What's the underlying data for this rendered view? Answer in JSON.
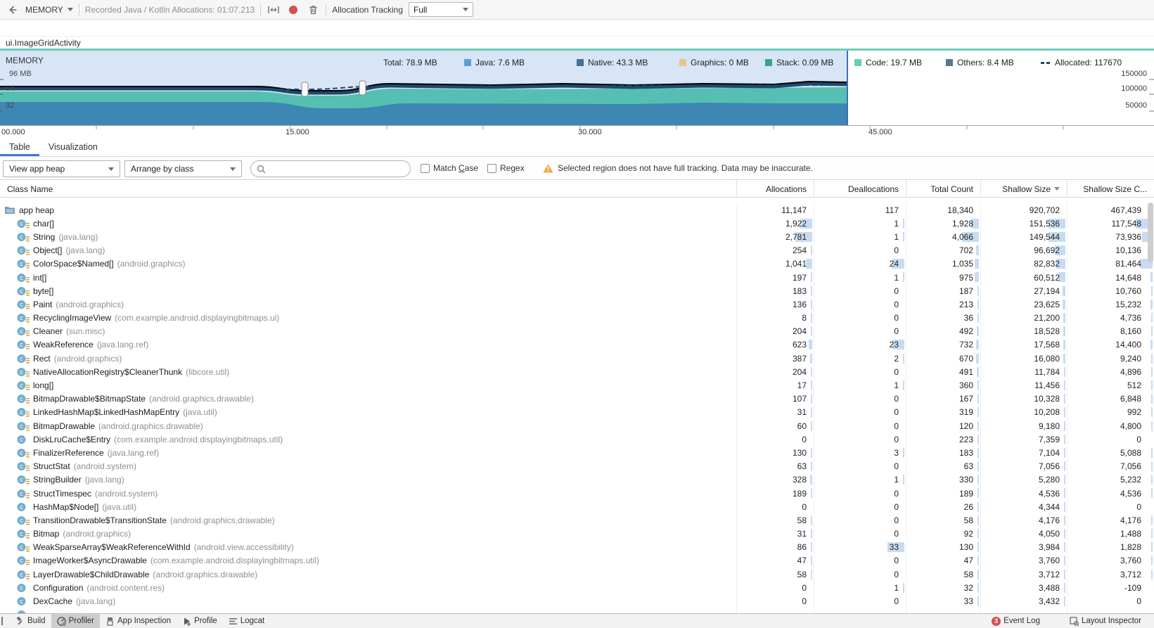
{
  "colors": {
    "accent_blue": "#3e7bc8",
    "selection_bg": "#d8e5f6",
    "event_pink": "#e18cad",
    "activity_teal": "#6cceba",
    "chart_blue_area": "#3e86b3",
    "chart_teal_area": "#55bfb1",
    "total_line": "#000000",
    "allocated_line": "#1d4a6e",
    "java": "#5b9fd3",
    "native": "#44719a",
    "graphics": "#e9c48e",
    "stack": "#39a28b",
    "code": "#68cfae",
    "others": "#56788e",
    "warning_orange": "#f0a732",
    "record_red": "#d6504f"
  },
  "toolbar": {
    "memory_label": "MEMORY",
    "session_label": "Recorded Java / Kotlin Allocations: 01:07.213",
    "tracking_label": "Allocation Tracking",
    "tracking_value": "Full"
  },
  "events": {
    "dots": [
      {
        "x": 412
      },
      {
        "x": 431
      },
      {
        "x": 445
      },
      {
        "x": 474
      },
      {
        "x": 502
      },
      {
        "x": 509
      },
      {
        "x": 516
      },
      {
        "x": 523
      },
      {
        "x": 530
      },
      {
        "x": 538
      },
      {
        "x": 550
      },
      {
        "x": 568
      },
      {
        "x": 851
      },
      {
        "x": 884
      },
      {
        "x": 898
      },
      {
        "x": 910
      },
      {
        "x": 921
      }
    ]
  },
  "activity": {
    "name": "ui.ImageGridActivity"
  },
  "chart": {
    "title": "MEMORY",
    "legend": {
      "total": "Total: 78.9 MB",
      "java": "Java: 7.6 MB",
      "native": "Native: 43.3 MB",
      "graphics": "Graphics: 0 MB",
      "stack": "Stack: 0.09 MB",
      "code": "Code: 19.7 MB",
      "others": "Others: 8.4 MB",
      "allocated": "Allocated: 117670"
    },
    "y_left": [
      "96 MB",
      "64",
      "32"
    ],
    "y_right": [
      "150000",
      "100000",
      "50000"
    ],
    "x_ticks": [
      "00.000",
      "15.000",
      "30.000",
      "45.000"
    ]
  },
  "tabs": {
    "table": "Table",
    "visualization": "Visualization"
  },
  "filters": {
    "view": "View app heap",
    "arrange": "Arrange by class",
    "search_value": "",
    "match_case": {
      "pre": "Match ",
      "u": "C",
      "post": "ase"
    },
    "regex": {
      "pre": "Re",
      "u": "g",
      "post": "ex"
    },
    "warning": "Selected region does not have full tracking. Data may be inaccurate."
  },
  "table": {
    "columns": {
      "name": "Class Name",
      "allocations": "Allocations",
      "deallocations": "Deallocations",
      "total": "Total Count",
      "shallow": "Shallow Size",
      "shallow_change": "Shallow Size C..."
    },
    "rows": [
      {
        "icon": "folder",
        "name": "app heap",
        "pkg": "",
        "a": "11,147",
        "d": "117",
        "t": "18,340",
        "s": "920,702",
        "c": "467,439",
        "agg": true
      },
      {
        "icon": "class",
        "name": "char[]",
        "pkg": "",
        "a": "1,922",
        "d": "1",
        "t": "1,928",
        "s": "151,536",
        "c": "117,548"
      },
      {
        "icon": "class",
        "name": "String",
        "pkg": "(java.lang)",
        "a": "2,781",
        "d": "1",
        "t": "4,066",
        "s": "149,544",
        "c": "73,936"
      },
      {
        "icon": "class",
        "name": "Object[]",
        "pkg": "(java.lang)",
        "a": "254",
        "d": "0",
        "t": "702",
        "s": "96,692",
        "c": "10,136"
      },
      {
        "icon": "class",
        "name": "ColorSpace$Named[]",
        "pkg": "(android.graphics)",
        "a": "1,041",
        "d": "24",
        "t": "1,035",
        "s": "82,832",
        "c": "81,464"
      },
      {
        "icon": "class",
        "name": "int[]",
        "pkg": "",
        "a": "197",
        "d": "1",
        "t": "975",
        "s": "60,512",
        "c": "14,648"
      },
      {
        "icon": "class",
        "name": "byte[]",
        "pkg": "",
        "a": "183",
        "d": "0",
        "t": "187",
        "s": "27,194",
        "c": "10,760"
      },
      {
        "icon": "class",
        "name": "Paint",
        "pkg": "(android.graphics)",
        "a": "136",
        "d": "0",
        "t": "213",
        "s": "23,625",
        "c": "15,232"
      },
      {
        "icon": "class",
        "name": "RecyclingImageView",
        "pkg": "(com.example.android.displayingbitmaps.ui)",
        "a": "8",
        "d": "0",
        "t": "36",
        "s": "21,200",
        "c": "4,736"
      },
      {
        "icon": "class",
        "name": "Cleaner",
        "pkg": "(sun.misc)",
        "a": "204",
        "d": "0",
        "t": "492",
        "s": "18,528",
        "c": "8,160"
      },
      {
        "icon": "class",
        "name": "WeakReference",
        "pkg": "(java.lang.ref)",
        "a": "623",
        "d": "23",
        "t": "732",
        "s": "17,568",
        "c": "14,400"
      },
      {
        "icon": "class",
        "name": "Rect",
        "pkg": "(android.graphics)",
        "a": "387",
        "d": "2",
        "t": "670",
        "s": "16,080",
        "c": "9,240"
      },
      {
        "icon": "class",
        "name": "NativeAllocationRegistry$CleanerThunk",
        "pkg": "(libcore.util)",
        "a": "204",
        "d": "0",
        "t": "491",
        "s": "11,784",
        "c": "4,896"
      },
      {
        "icon": "class",
        "name": "long[]",
        "pkg": "",
        "a": "17",
        "d": "1",
        "t": "360",
        "s": "11,456",
        "c": "512"
      },
      {
        "icon": "class",
        "name": "BitmapDrawable$BitmapState",
        "pkg": "(android.graphics.drawable)",
        "a": "107",
        "d": "0",
        "t": "167",
        "s": "10,328",
        "c": "6,848"
      },
      {
        "icon": "class",
        "name": "LinkedHashMap$LinkedHashMapEntry",
        "pkg": "(java.util)",
        "a": "31",
        "d": "0",
        "t": "319",
        "s": "10,208",
        "c": "992"
      },
      {
        "icon": "class",
        "name": "BitmapDrawable",
        "pkg": "(android.graphics.drawable)",
        "a": "60",
        "d": "0",
        "t": "120",
        "s": "9,180",
        "c": "4,800"
      },
      {
        "icon": "class-plain",
        "name": "DiskLruCache$Entry",
        "pkg": "(com.example.android.displayingbitmaps.util)",
        "a": "0",
        "d": "0",
        "t": "223",
        "s": "7,359",
        "c": "0"
      },
      {
        "icon": "class",
        "name": "FinalizerReference",
        "pkg": "(java.lang.ref)",
        "a": "130",
        "d": "3",
        "t": "183",
        "s": "7,104",
        "c": "5,088"
      },
      {
        "icon": "class",
        "name": "StructStat",
        "pkg": "(android.system)",
        "a": "63",
        "d": "0",
        "t": "63",
        "s": "7,056",
        "c": "7,056"
      },
      {
        "icon": "class",
        "name": "StringBuilder",
        "pkg": "(java.lang)",
        "a": "328",
        "d": "1",
        "t": "330",
        "s": "5,280",
        "c": "5,232"
      },
      {
        "icon": "class",
        "name": "StructTimespec",
        "pkg": "(android.system)",
        "a": "189",
        "d": "0",
        "t": "189",
        "s": "4,536",
        "c": "4,536"
      },
      {
        "icon": "class-plain",
        "name": "HashMap$Node[]",
        "pkg": "(java.util)",
        "a": "0",
        "d": "0",
        "t": "26",
        "s": "4,344",
        "c": "0"
      },
      {
        "icon": "class",
        "name": "TransitionDrawable$TransitionState",
        "pkg": "(android.graphics.drawable)",
        "a": "58",
        "d": "0",
        "t": "58",
        "s": "4,176",
        "c": "4,176"
      },
      {
        "icon": "class",
        "name": "Bitmap",
        "pkg": "(android.graphics)",
        "a": "31",
        "d": "0",
        "t": "92",
        "s": "4,050",
        "c": "1,488"
      },
      {
        "icon": "class",
        "name": "WeakSparseArray$WeakReferenceWithId",
        "pkg": "(android.view.accessibility)",
        "a": "86",
        "d": "33",
        "t": "130",
        "s": "3,984",
        "c": "1,828"
      },
      {
        "icon": "class",
        "name": "ImageWorker$AsyncDrawable",
        "pkg": "(com.example.android.displayingbitmaps.util)",
        "a": "47",
        "d": "0",
        "t": "47",
        "s": "3,760",
        "c": "3,760"
      },
      {
        "icon": "class",
        "name": "LayerDrawable$ChildDrawable",
        "pkg": "(android.graphics.drawable)",
        "a": "58",
        "d": "0",
        "t": "58",
        "s": "3,712",
        "c": "3,712"
      },
      {
        "icon": "class-plain",
        "name": "Configuration",
        "pkg": "(android.content.res)",
        "a": "0",
        "d": "1",
        "t": "32",
        "s": "3,488",
        "c": "-109"
      },
      {
        "icon": "class-plain",
        "name": "DexCache",
        "pkg": "(java.lang)",
        "a": "0",
        "d": "0",
        "t": "33",
        "s": "3,432",
        "c": "0"
      },
      {
        "icon": "class",
        "name": "",
        "pkg": "",
        "a": "",
        "d": "",
        "t": "",
        "s": "",
        "c": "",
        "agg": true
      }
    ]
  },
  "bottom_bar": {
    "build": "Build",
    "profiler": "Profiler",
    "app_inspection": "App Inspection",
    "profile": "Profile",
    "logcat": "Logcat",
    "event_log": {
      "badge": "3",
      "label": "Event Log"
    },
    "layout_inspector": "Layout Inspector"
  }
}
